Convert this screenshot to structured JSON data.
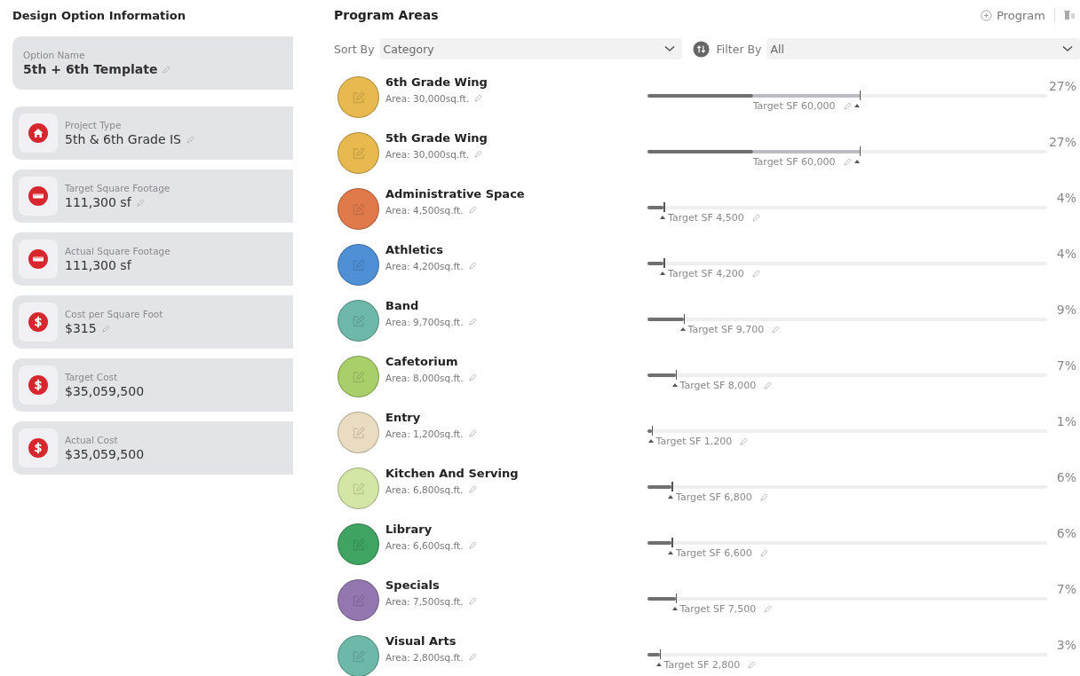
{
  "design_option": {
    "title": "Design Option Information",
    "option_name": {
      "label": "Option Name",
      "value": "5th + 6th Template",
      "editable": true
    },
    "cards": [
      {
        "kind": "project",
        "label": "Project Type",
        "value": "5th & 6th Grade IS",
        "editable": true
      },
      {
        "kind": "footage",
        "label": "Target Square Footage",
        "value": "111,300 sf",
        "editable": true
      },
      {
        "kind": "footage",
        "label": "Actual Square Footage",
        "value": "111,300 sf",
        "editable": false
      },
      {
        "kind": "cost",
        "label": "Cost per Square Foot",
        "value": "$315",
        "editable": true
      },
      {
        "kind": "cost",
        "label": "Target Cost",
        "value": "$35,059,500",
        "editable": false
      },
      {
        "kind": "cost",
        "label": "Actual Cost",
        "value": "$35,059,500",
        "editable": false
      }
    ]
  },
  "program_areas": {
    "title": "Program Areas",
    "add_button": "Program",
    "sort": {
      "label": "Sort By",
      "value": "Category"
    },
    "filter": {
      "label": "Filter By",
      "value": "All"
    },
    "rows": [
      {
        "name": "6th Grade Wing",
        "area": "Area: 30,000sq.ft.",
        "color": "#e8b94e",
        "bar": {
          "level": 0.265
        },
        "target": {
          "level": 0.53
        },
        "target_label": "Target SF 60,000",
        "percent": "27%"
      },
      {
        "name": "5th Grade Wing",
        "area": "Area: 30,000sq.ft.",
        "color": "#e8b94e",
        "bar": {
          "level": 0.265
        },
        "target": {
          "level": 0.53
        },
        "target_label": "Target SF 60,000",
        "percent": "27%"
      },
      {
        "name": "Administrative Space",
        "area": "Area: 4,500sq.ft.",
        "color": "#e07a4a",
        "bar": {
          "level": 0.04
        },
        "target": {
          "level": 0.04
        },
        "target_label": "Target SF 4,500",
        "percent": "4%"
      },
      {
        "name": "Athletics",
        "area": "Area: 4,200sq.ft.",
        "color": "#4f8fd6",
        "bar": {
          "level": 0.04
        },
        "target": {
          "level": 0.04
        },
        "target_label": "Target SF 4,200",
        "percent": "4%"
      },
      {
        "name": "Band",
        "area": "Area: 9,700sq.ft.",
        "color": "#6db8a8",
        "bar": {
          "level": 0.09
        },
        "target": {
          "level": 0.09
        },
        "target_label": "Target SF 9,700",
        "percent": "9%"
      },
      {
        "name": "Cafetorium",
        "area": "Area: 8,000sq.ft.",
        "color": "#a9cf6a",
        "bar": {
          "level": 0.07
        },
        "target": {
          "level": 0.07
        },
        "target_label": "Target SF 8,000",
        "percent": "7%"
      },
      {
        "name": "Entry",
        "area": "Area: 1,200sq.ft.",
        "color": "#eadcc0",
        "bar": {
          "level": 0.01
        },
        "target": {
          "level": 0.01
        },
        "target_label": "Target SF 1,200",
        "percent": "1%"
      },
      {
        "name": "Kitchen And Serving",
        "area": "Area: 6,800sq.ft.",
        "color": "#d4e6a6",
        "bar": {
          "level": 0.06
        },
        "target": {
          "level": 0.06
        },
        "target_label": "Target SF 6,800",
        "percent": "6%"
      },
      {
        "name": "Library",
        "area": "Area: 6,600sq.ft.",
        "color": "#3fa462",
        "bar": {
          "level": 0.06
        },
        "target": {
          "level": 0.06
        },
        "target_label": "Target SF 6,600",
        "percent": "6%"
      },
      {
        "name": "Specials",
        "area": "Area: 7,500sq.ft.",
        "color": "#9277b0",
        "bar": {
          "level": 0.07
        },
        "target": {
          "level": 0.07
        },
        "target_label": "Target SF 7,500",
        "percent": "7%"
      },
      {
        "name": "Visual Arts",
        "area": "Area: 2,800sq.ft.",
        "color": "#6db8a8",
        "bar": {
          "level": 0.03
        },
        "target": {
          "level": 0.03
        },
        "target_label": "Target SF 2,800",
        "percent": "3%"
      }
    ]
  }
}
